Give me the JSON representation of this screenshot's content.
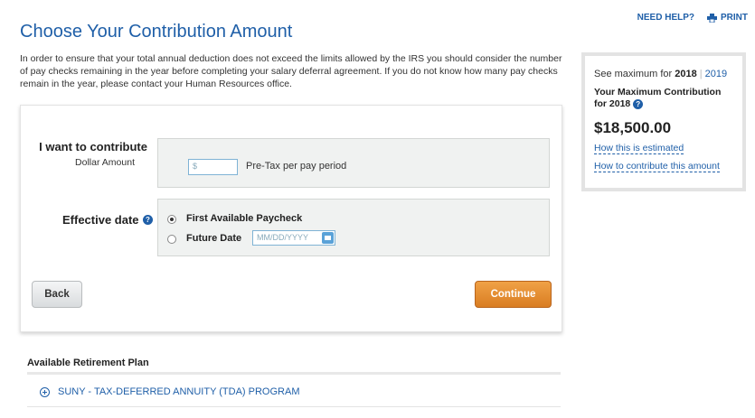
{
  "header": {
    "need_help": "NEED HELP?",
    "print": "PRINT",
    "title": "Choose Your Contribution Amount",
    "intro": "In order to ensure that your total annual deduction does not exceed the limits allowed by the IRS you should consider the number of pay checks remaining in the year before completing your salary deferral agreement. If you do not know how many pay checks remain in the year, please contact your Human Resources office."
  },
  "form": {
    "contribute_label": "I want to contribute",
    "contribute_sub": "Dollar Amount",
    "dollar_placeholder": "$",
    "pretax_text": "Pre-Tax per pay period",
    "effective_label": "Effective date",
    "options": [
      {
        "label": "First Available Paycheck",
        "selected": true
      },
      {
        "label": "Future Date",
        "selected": false
      }
    ],
    "date_placeholder": "MM/DD/YYYY",
    "back_label": "Back",
    "continue_label": "Continue"
  },
  "sidebar": {
    "see_prefix": "See maximum for",
    "year_selected": "2018",
    "year_other": "2019",
    "max_label": "Your Maximum Contribution for 2018",
    "amount": "$18,500.00",
    "link_estimated": "How this is estimated",
    "link_contribute": "How to contribute this amount"
  },
  "plans": {
    "title": "Available Retirement Plan",
    "items": [
      "SUNY - TAX-DEFERRED ANNUITY (TDA) PROGRAM"
    ]
  },
  "colors": {
    "link_blue": "#1f5fa8",
    "continue_orange": "#e38a2c"
  },
  "icons": [
    "help-icon",
    "print-icon",
    "calendar-icon",
    "expand-plus-icon"
  ]
}
